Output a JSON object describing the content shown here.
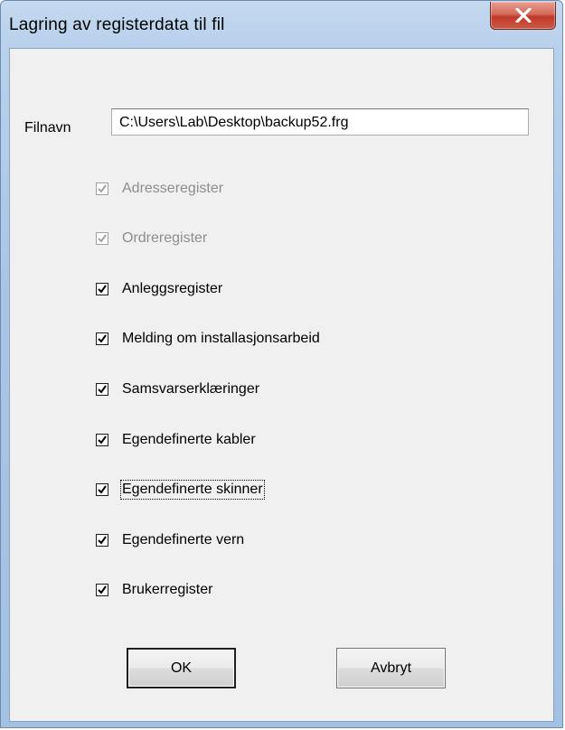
{
  "window": {
    "title": "Lagring av registerdata til fil"
  },
  "file": {
    "label": "Filnavn",
    "value": "C:\\Users\\Lab\\Desktop\\backup52.frg"
  },
  "checkboxes": [
    {
      "label": "Adresseregister",
      "checked": true,
      "enabled": false
    },
    {
      "label": "Ordreregister",
      "checked": true,
      "enabled": false
    },
    {
      "label": "Anleggsregister",
      "checked": true,
      "enabled": true
    },
    {
      "label": "Melding om installasjonsarbeid",
      "checked": true,
      "enabled": true
    },
    {
      "label": "Samsvarserklæringer",
      "checked": true,
      "enabled": true
    },
    {
      "label": "Egendefinerte kabler",
      "checked": true,
      "enabled": true
    },
    {
      "label": "Egendefinerte skinner",
      "checked": true,
      "enabled": true,
      "focused": true
    },
    {
      "label": "Egendefinerte vern",
      "checked": true,
      "enabled": true
    },
    {
      "label": "Brukerregister",
      "checked": true,
      "enabled": true
    }
  ],
  "buttons": {
    "ok_label": "OK",
    "cancel_label": "Avbryt"
  },
  "icons": {
    "close": "close-icon",
    "check": "checkmark-icon"
  },
  "colors": {
    "title_bar": "#b9d1ec",
    "close_button": "#c0392b",
    "client_bg": "#f0f0f0",
    "disabled_text": "#8d8d8d"
  }
}
